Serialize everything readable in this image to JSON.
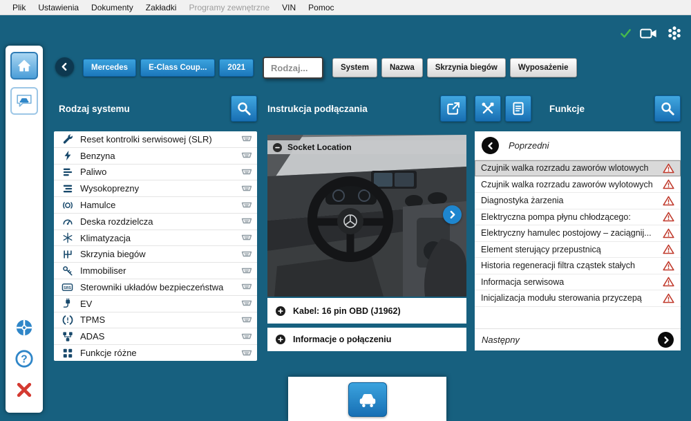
{
  "menu": {
    "items": [
      {
        "label": "Plik",
        "enabled": true
      },
      {
        "label": "Ustawienia",
        "enabled": true
      },
      {
        "label": "Dokumenty",
        "enabled": true
      },
      {
        "label": "Zakładki",
        "enabled": true
      },
      {
        "label": "Programy zewnętrzne",
        "enabled": false
      },
      {
        "label": "VIN",
        "enabled": true
      },
      {
        "label": "Pomoc",
        "enabled": true
      }
    ]
  },
  "topbar": {
    "brand": "Mercedes",
    "model": "E-Class Coup...",
    "year": "2021",
    "type_field": "Rodzaj...",
    "filters": [
      {
        "label": "System"
      },
      {
        "label": "Nazwa"
      },
      {
        "label": "Skrzynia biegów"
      },
      {
        "label": "Wyposażenie"
      }
    ]
  },
  "left_panel": {
    "title": "Rodzaj systemu",
    "items": [
      {
        "label": "Reset kontrolki serwisowej (SLR)",
        "icon": "service-reset"
      },
      {
        "label": "Benzyna",
        "icon": "petrol"
      },
      {
        "label": "Paliwo",
        "icon": "fuel"
      },
      {
        "label": "Wysokoprezny",
        "icon": "diesel"
      },
      {
        "label": "Hamulce",
        "icon": "brakes"
      },
      {
        "label": "Deska rozdzielcza",
        "icon": "dashboard"
      },
      {
        "label": "Klimatyzacja",
        "icon": "climate"
      },
      {
        "label": "Skrzynia biegów",
        "icon": "gearbox"
      },
      {
        "label": "Immobiliser",
        "icon": "immobiliser"
      },
      {
        "label": "Sterowniki układów bezpieczeństwa",
        "icon": "srs"
      },
      {
        "label": "EV",
        "icon": "ev"
      },
      {
        "label": "TPMS",
        "icon": "tpms"
      },
      {
        "label": "ADAS",
        "icon": "adas"
      },
      {
        "label": "Funkcje różne",
        "icon": "misc-functions"
      }
    ]
  },
  "middle_panel": {
    "title": "Instrukcja podłączania",
    "sections": {
      "photo": "Socket Location",
      "cable": "Kabel: 16 pin OBD (J1962)",
      "info": "Informacje o połączeniu"
    }
  },
  "right_panel": {
    "title": "Funkcje",
    "previous": "Poprzedni",
    "next": "Następny",
    "items": [
      {
        "label": "Czujnik walka rozrzadu zaworów wlotowych",
        "selected": true
      },
      {
        "label": "Czujnik walka rozrzadu zaworów wylotowych",
        "selected": false
      },
      {
        "label": "Diagnostyka żarzenia",
        "selected": false
      },
      {
        "label": "Elektryczna pompa płynu chłodzącego:",
        "selected": false
      },
      {
        "label": "Elektryczny hamulec postojowy – zaciągnij...",
        "selected": false
      },
      {
        "label": "Element sterujący przepustnicą",
        "selected": false
      },
      {
        "label": "Historia regeneracji filtra cząstek stałych",
        "selected": false
      },
      {
        "label": "Informacja serwisowa",
        "selected": false
      },
      {
        "label": "Inicjalizacja modułu sterowania przyczepą",
        "selected": false
      }
    ]
  },
  "colors": {
    "background": "#17607f",
    "accent_blue": "#1e86cf",
    "warning_red": "#c0392b",
    "success_green": "#46b94d"
  }
}
